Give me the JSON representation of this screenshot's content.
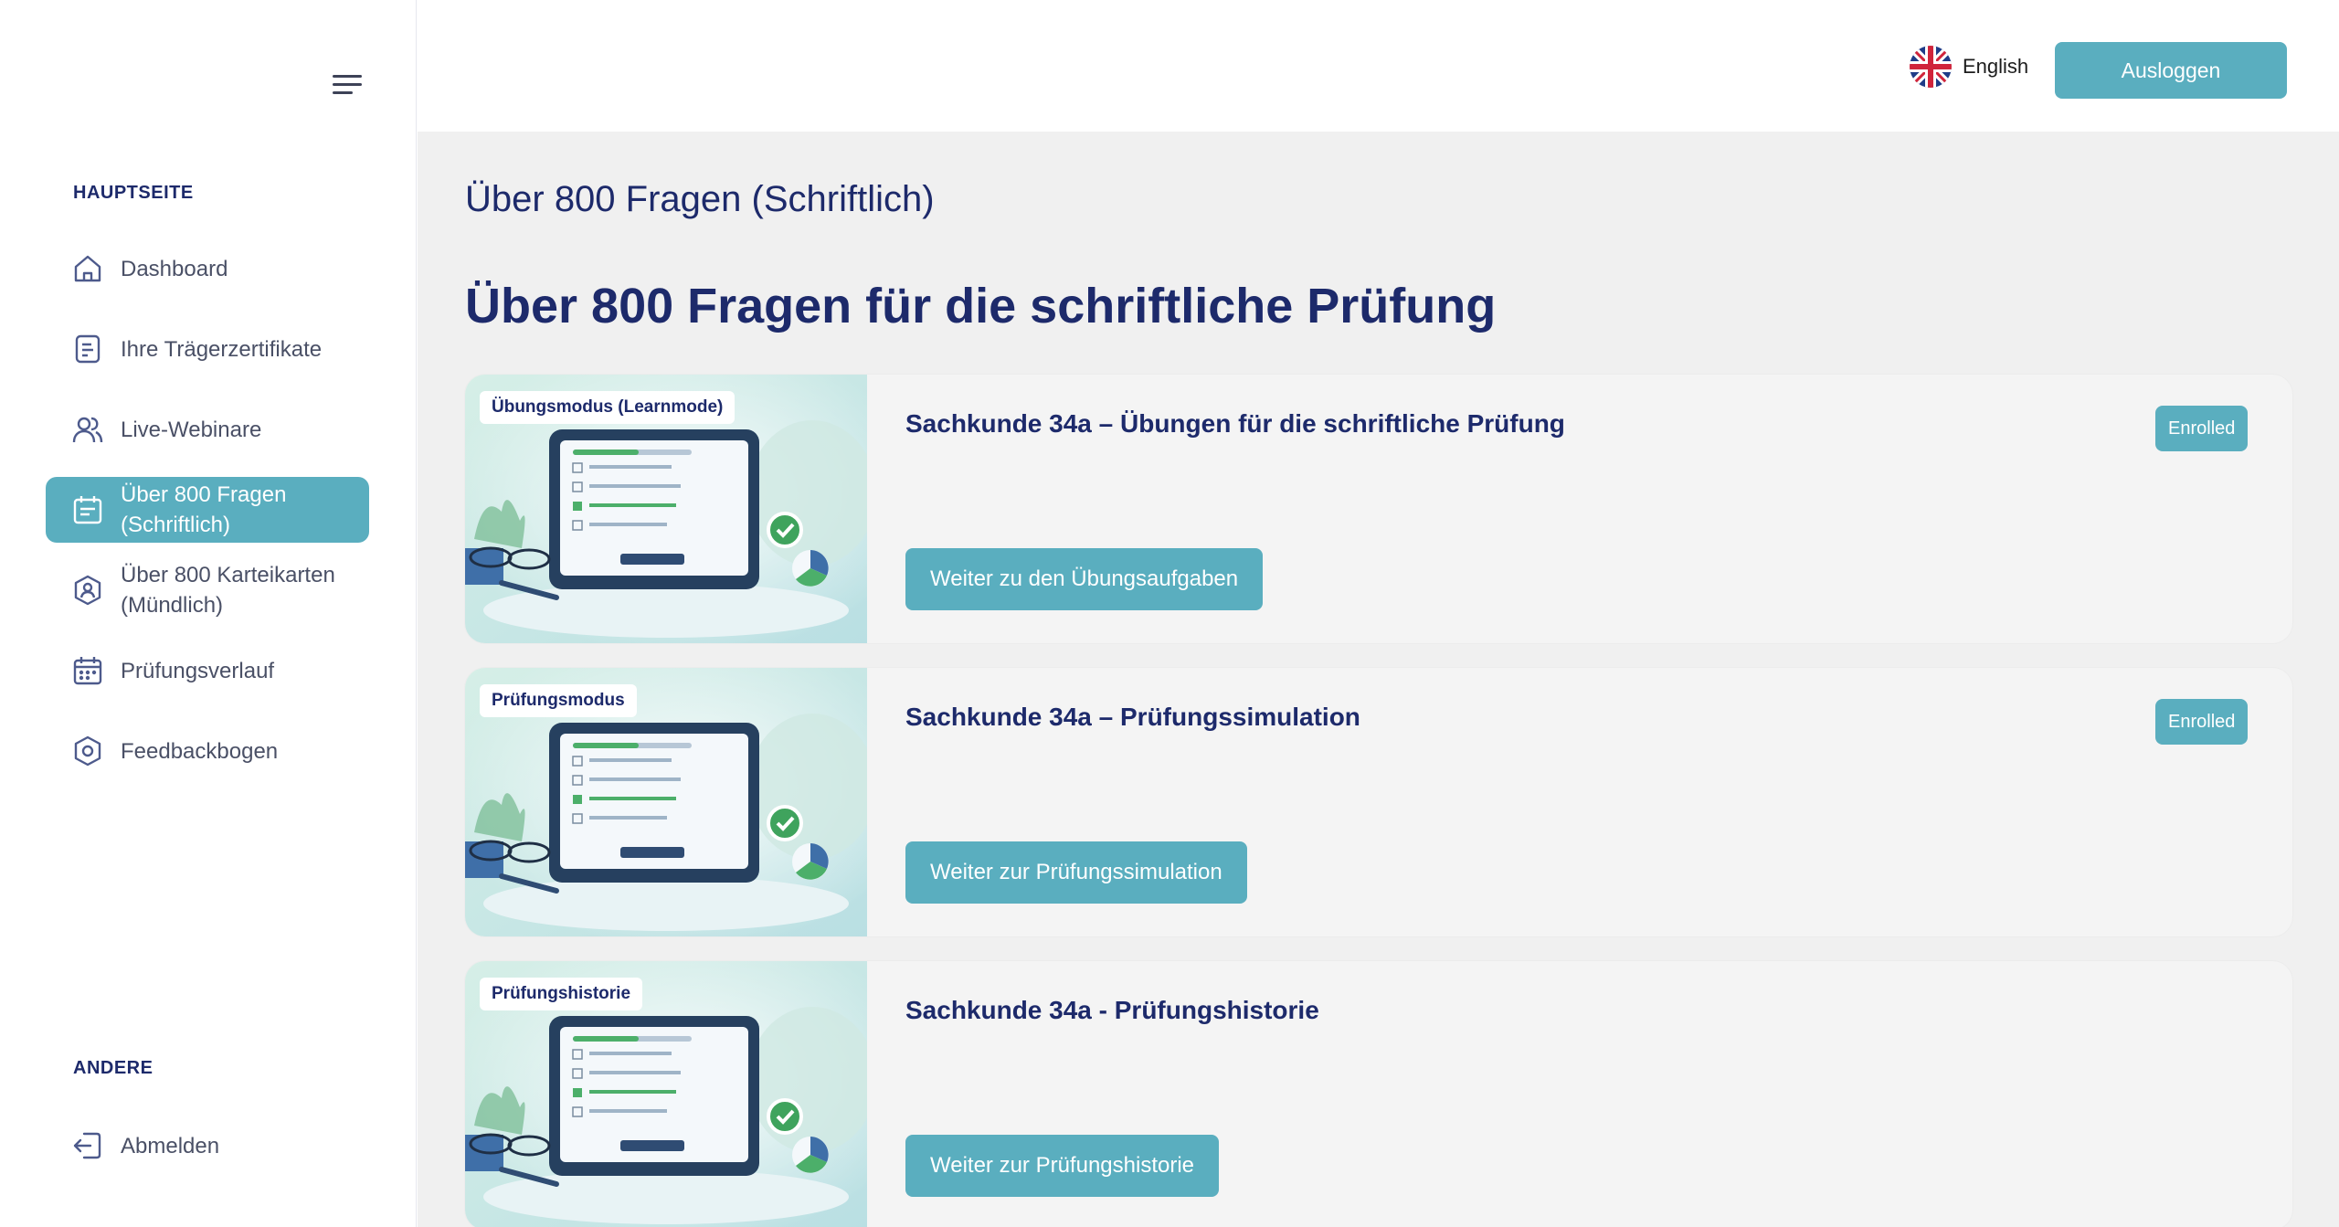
{
  "sidebar": {
    "sections": {
      "main_title": "HAUPTSEITE",
      "other_title": "ANDERE"
    },
    "items": [
      {
        "label": "Dashboard",
        "icon": "home-icon"
      },
      {
        "label": "Ihre Trägerzertifikate",
        "icon": "certificate-icon"
      },
      {
        "label": "Live-Webinare",
        "icon": "users-icon"
      },
      {
        "label": "Über 800 Fragen (Schriftlich)",
        "icon": "questions-icon",
        "active": true
      },
      {
        "label": "Über 800 Karteikarten (Mündlich)",
        "icon": "flashcards-icon"
      },
      {
        "label": "Prüfungsverlauf",
        "icon": "calendar-icon"
      },
      {
        "label": "Feedbackbogen",
        "icon": "feedback-icon"
      }
    ],
    "other_items": [
      {
        "label": "Abmelden",
        "icon": "logout-icon"
      }
    ]
  },
  "header": {
    "language": "English",
    "language_icon": "uk-flag-icon",
    "logout_label": "Ausloggen"
  },
  "main": {
    "breadcrumb": "Über 800 Fragen (Schriftlich)",
    "title": "Über 800 Fragen für die schriftliche Prüfung",
    "cards": [
      {
        "thumb_label": "Übungsmodus (Learnmode)",
        "title": "Sachkunde 34a – Übungen für die schriftliche Prüfung",
        "badge": "Enrolled",
        "button": "Weiter zu den Übungsaufgaben"
      },
      {
        "thumb_label": "Prüfungsmodus",
        "title": "Sachkunde 34a – Prüfungssimulation",
        "badge": "Enrolled",
        "button": "Weiter zur Prüfungssimulation"
      },
      {
        "thumb_label": "Prüfungshistorie",
        "title": "Sachkunde 34a - Prüfungshistorie",
        "button": "Weiter zur Prüfungshistorie"
      }
    ]
  },
  "colors": {
    "accent": "#5aaebf",
    "navy": "#1d2a6b",
    "background": "#f0f0f0"
  }
}
